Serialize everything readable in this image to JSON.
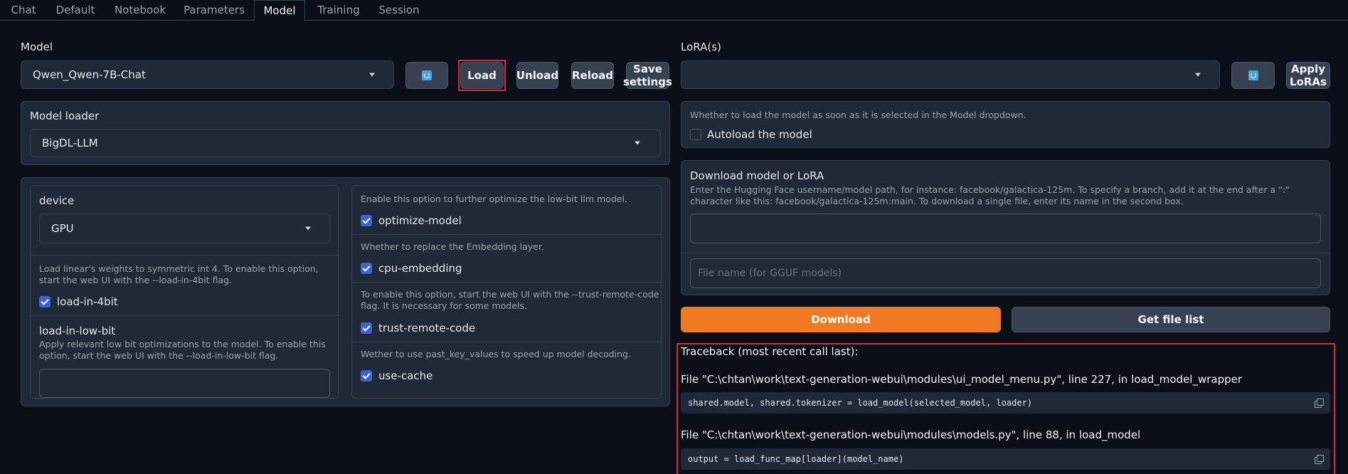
{
  "tabs": [
    "Chat",
    "Default",
    "Notebook",
    "Parameters",
    "Model",
    "Training",
    "Session"
  ],
  "active_tab": "Model",
  "model": {
    "label": "Model",
    "selected": "Qwen_Qwen-7B-Chat",
    "load_label": "Load",
    "unload_label": "Unload",
    "reload_label": "Reload",
    "save_settings_label_1": "Save",
    "save_settings_label_2": "settings"
  },
  "model_loader": {
    "label": "Model loader",
    "selected": "BigDL-LLM"
  },
  "device": {
    "label": "device",
    "selected": "GPU"
  },
  "load_in_4bit": {
    "info": "Load linear's weights to symmetric int 4. To enable this option, start the web UI with the --load-in-4bit flag.",
    "label": "load-in-4bit",
    "checked": true
  },
  "load_in_low_bit": {
    "label": "load-in-low-bit",
    "info": "Apply relevant low bit optimizations to the model. To enable this option, start the web UI with the --load-in-low-bit flag.",
    "value": ""
  },
  "optimize_model": {
    "info": "Enable this option to further optimize the low-bit llm model.",
    "label": "optimize-model",
    "checked": true
  },
  "cpu_embedding": {
    "info": "Whether to replace the Embedding layer.",
    "label": "cpu-embedding",
    "checked": true
  },
  "trust_remote_code": {
    "info": "To enable this option, start the web UI with the --trust-remote-code flag. It is necessary for some models.",
    "label": "trust-remote-code",
    "checked": true
  },
  "use_cache": {
    "info": "Wether to use past_key_values to speed up model decoding.",
    "label": "use-cache",
    "checked": true
  },
  "lora": {
    "label": "LoRA(s)",
    "selected": "",
    "apply_label_1": "Apply",
    "apply_label_2": "LoRAs"
  },
  "autoload": {
    "info": "Whether to load the model as soon as it is selected in the Model dropdown.",
    "label": "Autoload the model",
    "checked": false
  },
  "download": {
    "title": "Download model or LoRA",
    "info": "Enter the Hugging Face username/model path, for instance: facebook/galactica-125m. To specify a branch, add it at the end after a \":\" character like this: facebook/galactica-125m:main. To download a single file, enter its name in the second box.",
    "path_value": "",
    "filename_placeholder": "File name (for GGUF models)",
    "download_label": "Download",
    "get_file_list_label": "Get file list"
  },
  "traceback": {
    "header": "Traceback (most recent call last):",
    "frames": [
      {
        "file_line": "File \"C:\\chtan\\work\\text-generation-webui\\modules\\ui_model_menu.py\", line 227, in load_model_wrapper",
        "code": "shared.model, shared.tokenizer = load_model(selected_model, loader)"
      },
      {
        "file_line": "File \"C:\\chtan\\work\\text-generation-webui\\modules\\models.py\", line 88, in load_model",
        "code": "output = load_func_map[loader](model_name)"
      }
    ]
  },
  "colors": {
    "accent": "#3b63d6",
    "primary_button": "#f97316",
    "highlight": "#d92b2b"
  }
}
